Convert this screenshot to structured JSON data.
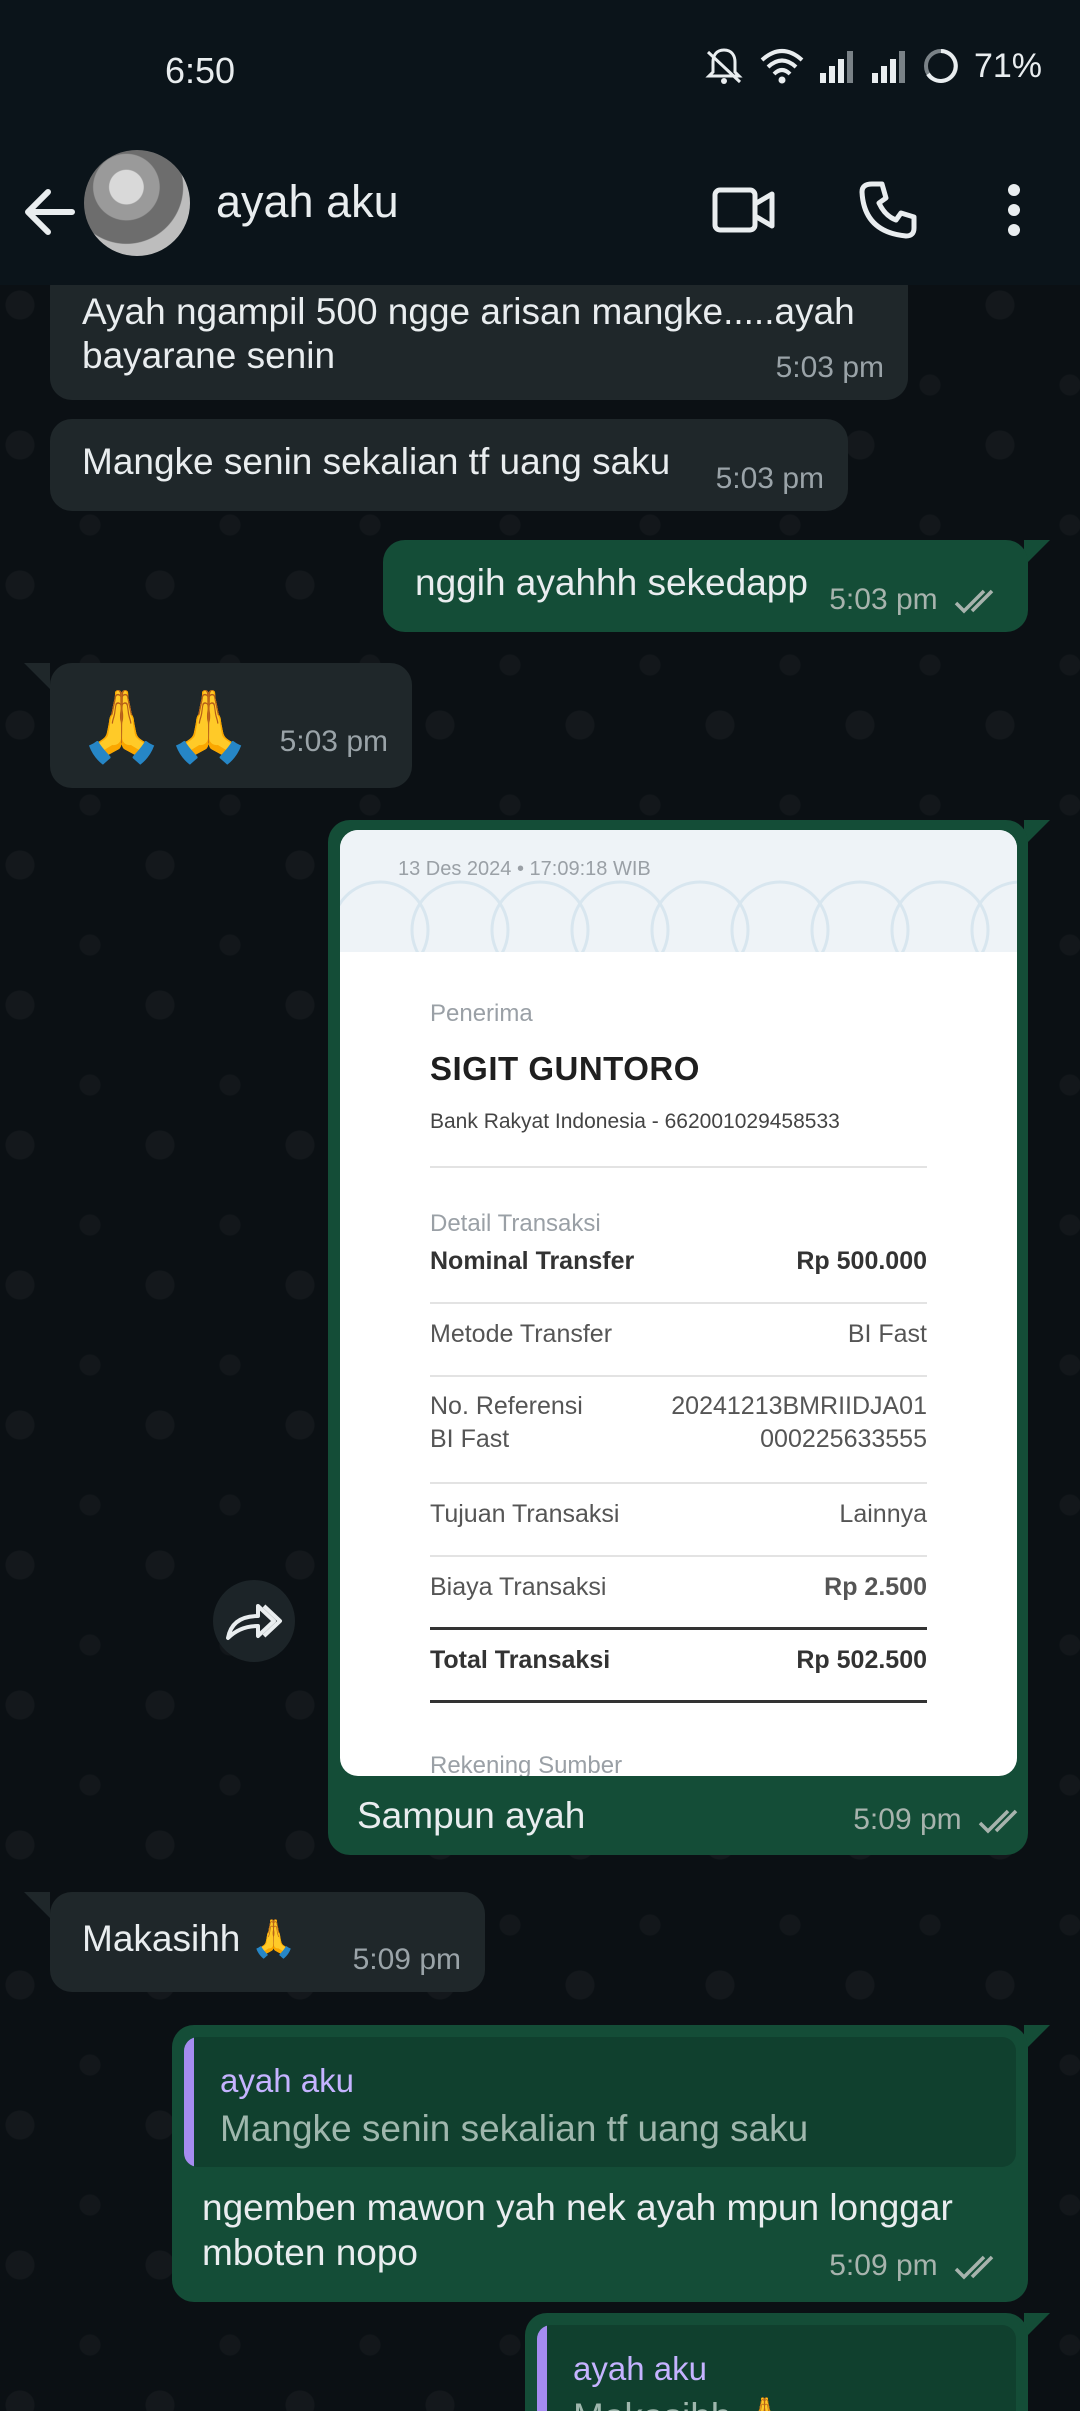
{
  "status_bar": {
    "time": "6:50",
    "battery": "71%",
    "icons": [
      "mute-icon",
      "wifi-icon",
      "signal-icon",
      "signal-icon",
      "battery-icon"
    ]
  },
  "header": {
    "back_icon": "arrow-left-icon",
    "contact_name": "ayah aku",
    "video_icon": "video-call-icon",
    "call_icon": "phone-icon",
    "menu_icon": "more-vert-icon"
  },
  "colors": {
    "outgoing": "#144d37",
    "incoming": "#1f272a",
    "background": "#0b1014",
    "quote_bar": "#a58cf0"
  },
  "messages": [
    {
      "dir": "in",
      "text": "Ayah ngampil 500 ngge arisan mangke.....ayah bayarane senin",
      "time": "5:03 pm"
    },
    {
      "dir": "in",
      "text": "Mangke senin sekalian tf uang saku",
      "time": "5:03 pm"
    },
    {
      "dir": "out",
      "text": "nggih ayahhh sekedapp",
      "time": "5:03 pm",
      "status": "read"
    },
    {
      "dir": "in",
      "text": "🙏🙏",
      "time": "5:03 pm"
    },
    {
      "dir": "out",
      "text": "Sampun ayah",
      "time": "5:09 pm",
      "status": "read"
    },
    {
      "dir": "in",
      "text": "Makasihh 🙏",
      "time": "5:09 pm"
    },
    {
      "dir": "out",
      "quote_name": "ayah aku",
      "quote_text": "Mangke senin sekalian tf uang saku",
      "text": "ngemben mawon yah nek ayah mpun longgar mboten nopo",
      "time": "5:09 pm",
      "status": "read"
    },
    {
      "dir": "out",
      "quote_name": "ayah aku",
      "quote_text": "Makasihh 🙏"
    }
  ],
  "receipt": {
    "datetime": "13 Des 2024 • 17:09:18 WIB",
    "recipient_label": "Penerima",
    "recipient_name": "SIGIT GUNTORO",
    "recipient_bank": "Bank Rakyat Indonesia - 662001029458533",
    "detail_label": "Detail Transaksi",
    "rows": [
      {
        "label": "Nominal Transfer",
        "value": "Rp 500.000"
      },
      {
        "label": "Metode Transfer",
        "value": "BI Fast"
      },
      {
        "label": "No. Referensi",
        "label2": "BI Fast",
        "value": "20241213BMRIIDJA01",
        "value2": "000225633555"
      },
      {
        "label": "Tujuan Transaksi",
        "value": "Lainnya"
      },
      {
        "label": "Biaya Transaksi",
        "value": "Rp 2.500"
      },
      {
        "label": "Total Transaksi",
        "value": "Rp 502.500"
      }
    ],
    "next_label": "Rekening Sumber"
  },
  "forward_icon": "forward-icon"
}
